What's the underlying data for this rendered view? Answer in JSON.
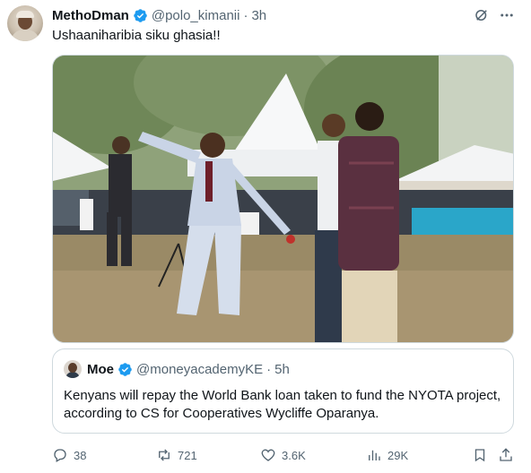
{
  "tweet": {
    "author_name": "MethoDman",
    "author_handle": "@polo_kimanii",
    "separator": "·",
    "time": "3h",
    "text": "Ushaaniharibia siku ghasia!!"
  },
  "quote": {
    "author_name": "Moe",
    "author_handle": "@moneyacademyKE",
    "separator": "·",
    "time": "5h",
    "text": "Kenyans will repay the World Bank loan taken to fund the NYOTA project, according to CS for Cooperatives Wycliffe Oparanya."
  },
  "actions": {
    "replies": "38",
    "reposts": "721",
    "likes": "3.6K",
    "views": "29K"
  },
  "colors": {
    "verified": "#1d9bf0",
    "secondary_text": "#536471",
    "border": "#cfd9de"
  },
  "icons": [
    "verified-badge-icon",
    "grok-icon",
    "more-icon",
    "reply-icon",
    "repost-icon",
    "like-icon",
    "views-icon",
    "bookmark-icon",
    "share-icon"
  ]
}
